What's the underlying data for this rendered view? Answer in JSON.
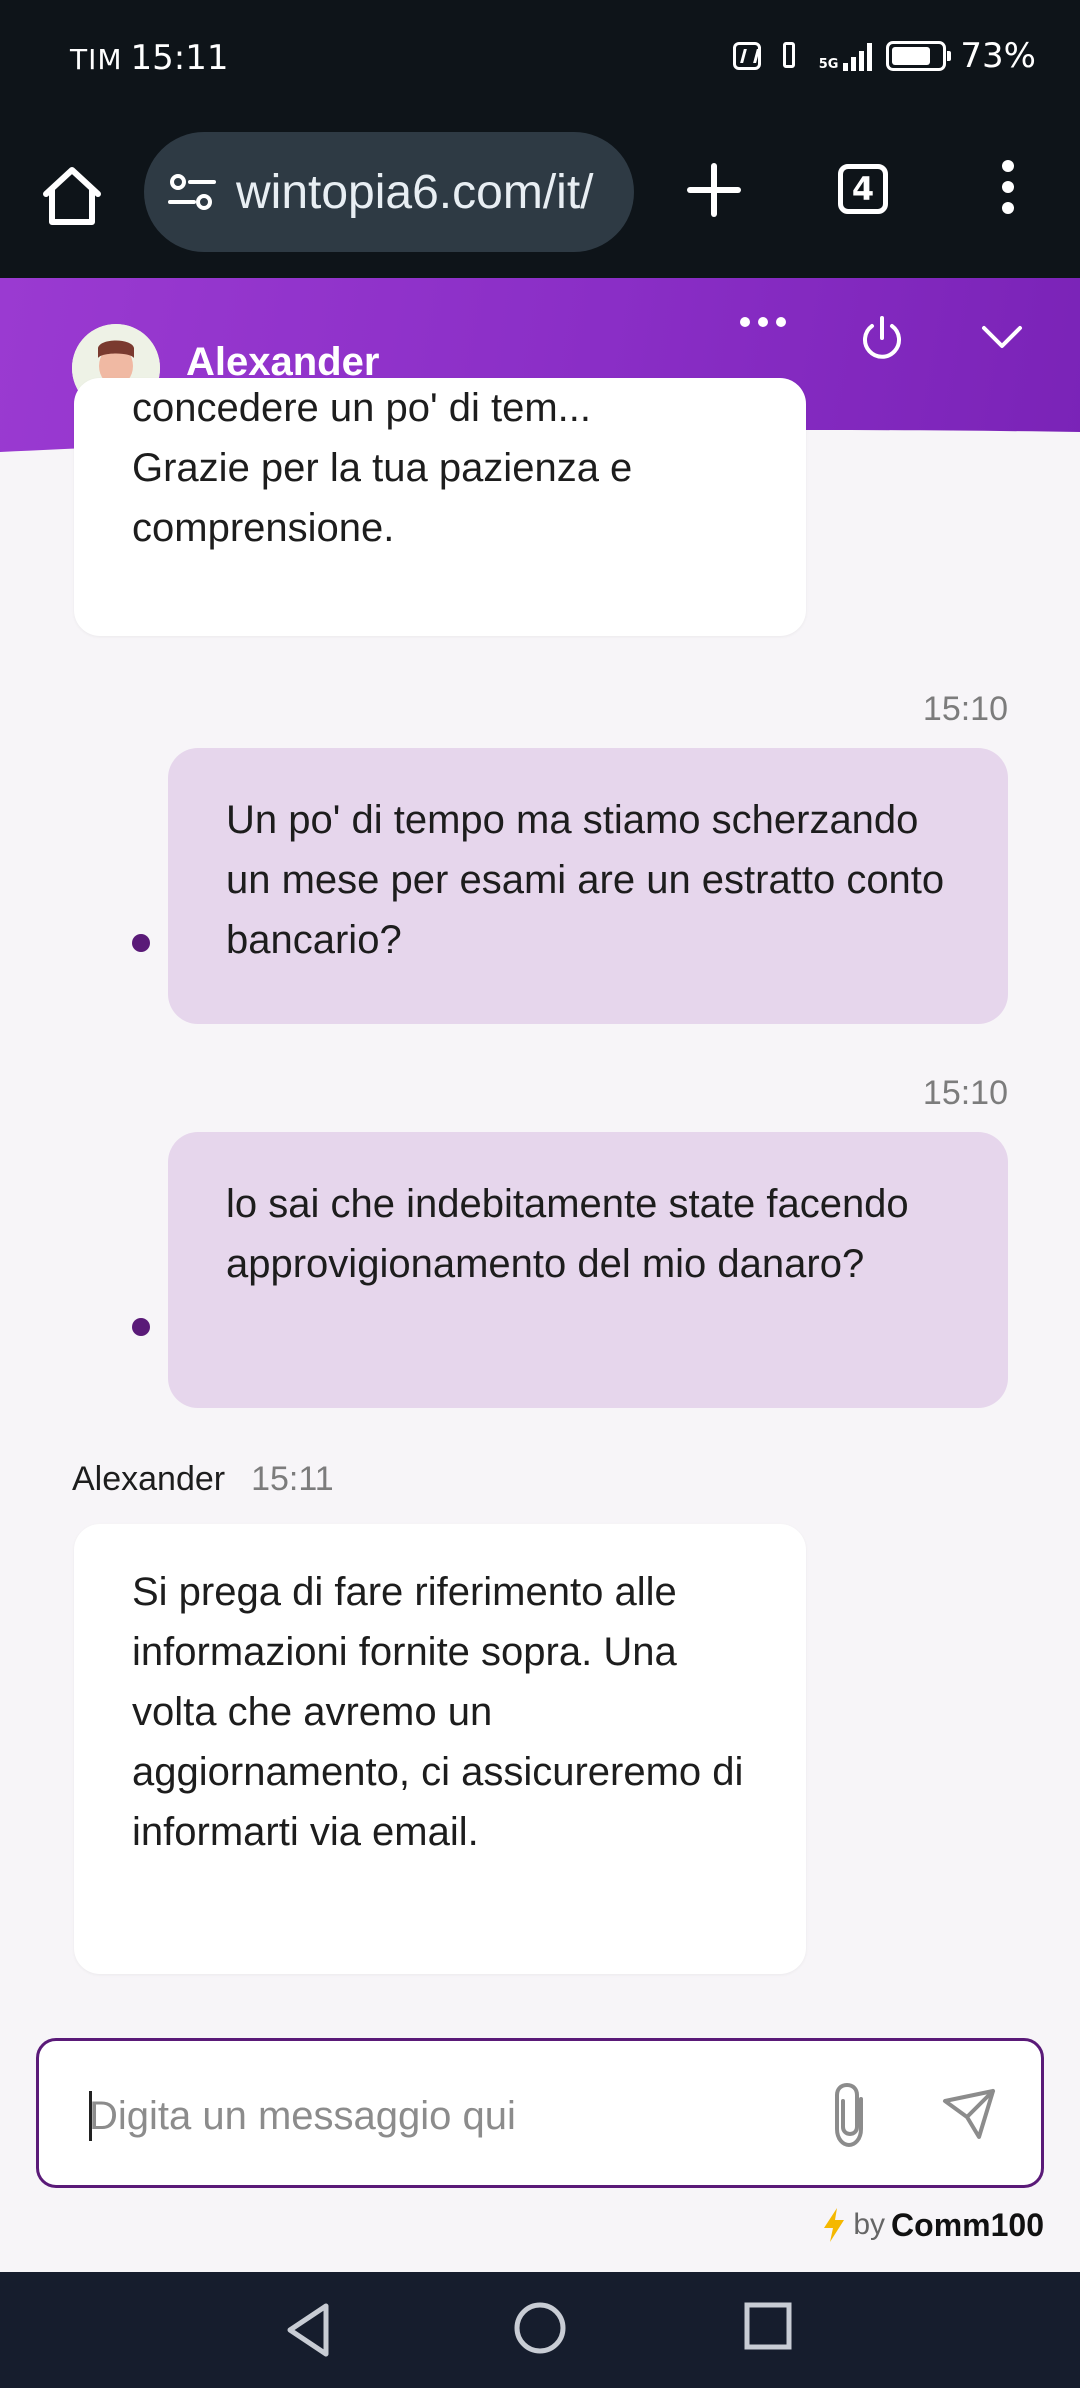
{
  "status_bar": {
    "carrier": "TIM",
    "time": "15:11",
    "network": "5G",
    "battery": "73%"
  },
  "browser": {
    "url": "wintopia6.com/it/",
    "tab_count": "4",
    "icons": [
      "home-icon",
      "site-settings-icon",
      "new-tab-icon",
      "tabs-icon",
      "more-vert-icon"
    ]
  },
  "chat_header": {
    "agent_name": "Alexander",
    "accent_color": "#8a2ec6",
    "icons": [
      "more-horiz-icon",
      "power-icon",
      "chevron-down-icon"
    ]
  },
  "messages": [
    {
      "type": "incoming",
      "lines": [
        "concedere un po' di tem...",
        "Grazie per la tua pazienza e",
        "comprensione."
      ]
    },
    {
      "type": "outgoing",
      "time": "15:10",
      "text": "Un po' di tempo ma stiamo scherzando un mese per esami are un estratto conto bancario?"
    },
    {
      "type": "outgoing",
      "time": "15:10",
      "text": "lo sai che indebitamente state facendo approvigionamento del mio danaro?"
    },
    {
      "type": "incoming",
      "sender": "Alexander",
      "time": "15:11",
      "text": "Si prega di fare riferimento alle informazioni fornite sopra. Una volta che avremo un aggiornamento, ci assicureremo di informarti via email."
    }
  ],
  "composer": {
    "placeholder": "Digita un messaggio qui",
    "value": ""
  },
  "branding": {
    "by": "by",
    "brand": "Comm100"
  },
  "navigation": {
    "icons": [
      "back-icon",
      "home-circle-icon",
      "recents-icon"
    ]
  }
}
